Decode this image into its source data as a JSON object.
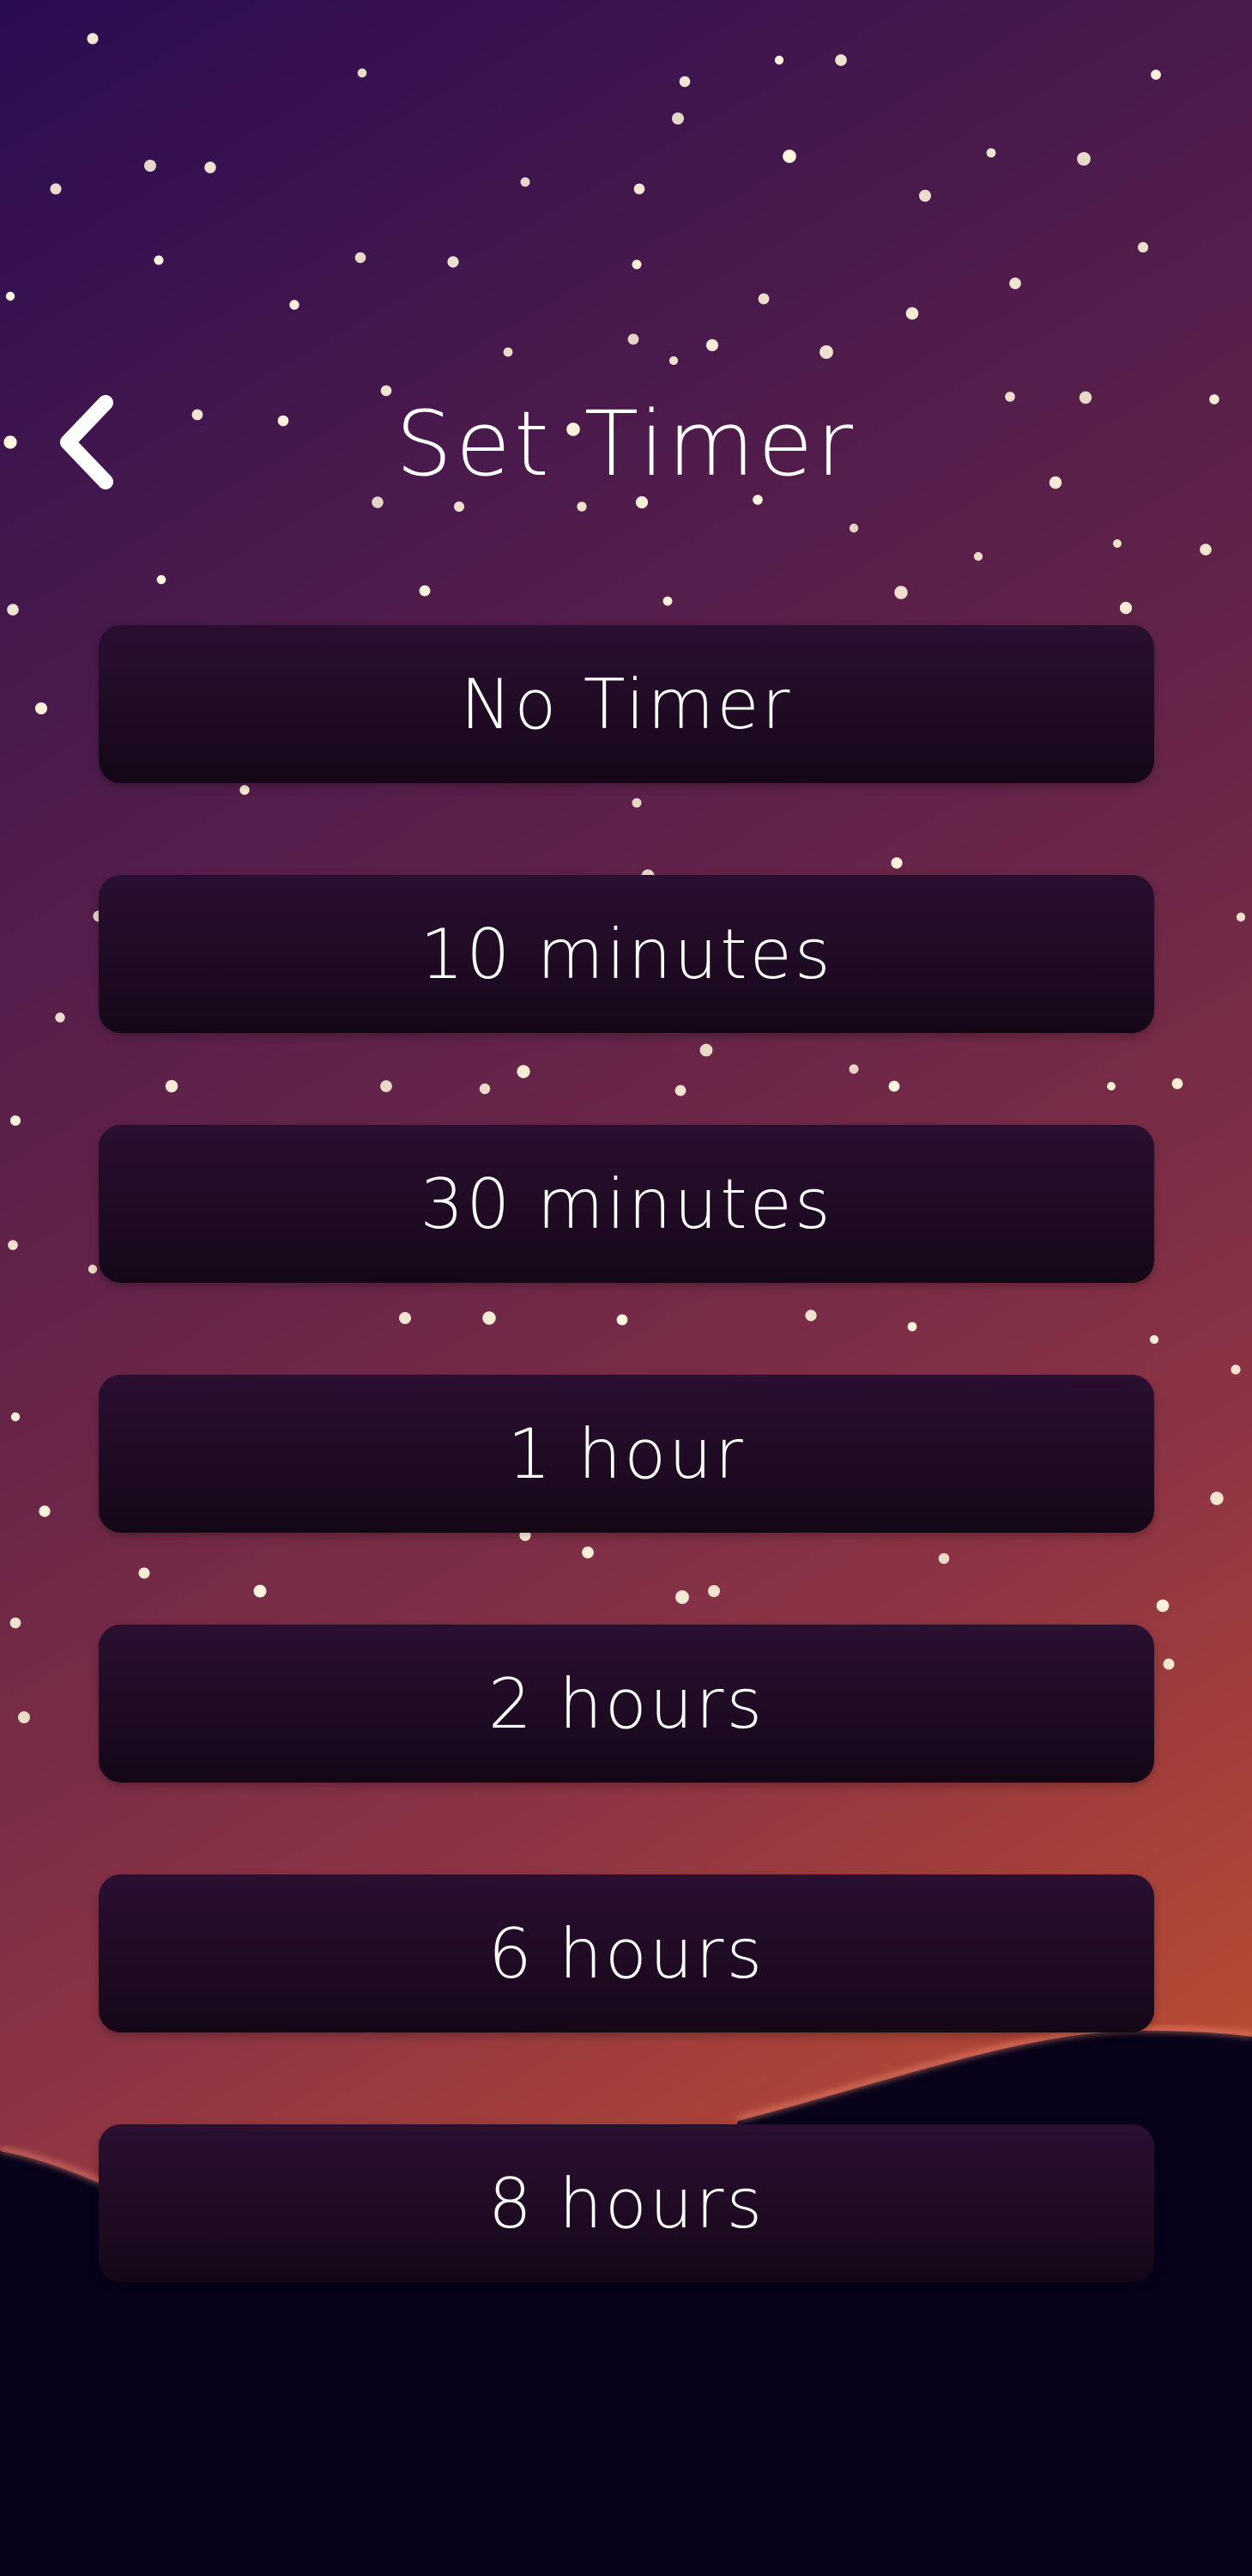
{
  "header": {
    "title": "Set Timer",
    "back_icon": "chevron-left-icon"
  },
  "timer_options": [
    {
      "label": "No Timer"
    },
    {
      "label": "10 minutes"
    },
    {
      "label": "30 minutes"
    },
    {
      "label": "1 hour"
    },
    {
      "label": "2 hours"
    },
    {
      "label": "6 hours"
    },
    {
      "label": "8 hours"
    }
  ],
  "theme": {
    "sky_top": "#2a0c52",
    "sky_bottom": "#c0502f",
    "ground": "#07021a",
    "button_bg": "#1c0a20",
    "text": "#ffffff",
    "star": "#fff6dd"
  },
  "background": {
    "decoration": "night-sky-stars-icon"
  }
}
